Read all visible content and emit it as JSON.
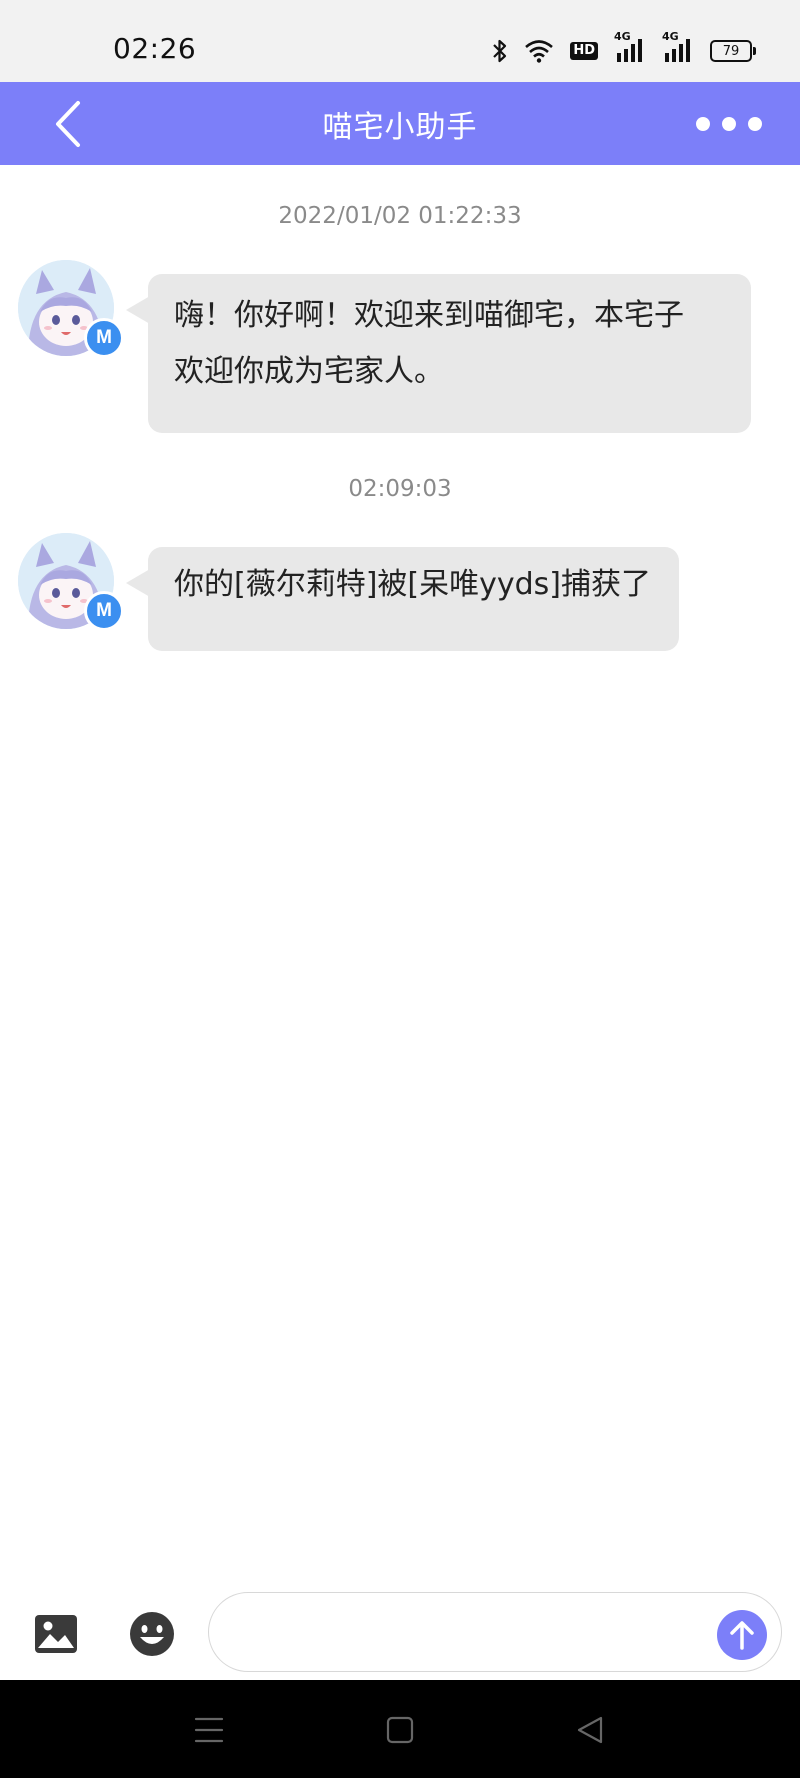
{
  "status_bar": {
    "time": "02:26",
    "icons": [
      "bluetooth-icon",
      "wifi-icon",
      "hd-icon",
      "signal-4g-icon",
      "signal-4g-icon"
    ],
    "hd_label": "HD",
    "network_labels": [
      "4G",
      "4G"
    ],
    "battery_level": "79"
  },
  "header": {
    "title": "喵宅小助手",
    "back_icon": "chevron-left-icon",
    "more_icon": "more-dots-icon"
  },
  "chat": {
    "messages": [
      {
        "timestamp": "2022/01/02 01:22:33",
        "avatar_badge": "M",
        "lines": [
          "嗨！你好啊！欢迎来到喵御宅，本宅子",
          "欢迎你成为宅家人。"
        ]
      },
      {
        "timestamp": "02:09:03",
        "avatar_badge": "M",
        "lines": [
          "你的[薇尔莉特]被[呆唯yyds]捕获了"
        ]
      }
    ]
  },
  "composer": {
    "image_icon": "image-icon",
    "emoji_icon": "emoji-icon",
    "input_value": "",
    "send_icon": "arrow-up-icon"
  },
  "system_nav": {
    "icons": [
      "menu-icon",
      "home-square-icon",
      "back-triangle-icon"
    ]
  },
  "colors": {
    "accent": "#7c7ff9",
    "bubble": "#e8e8e8",
    "badge": "#3b8ff0"
  }
}
